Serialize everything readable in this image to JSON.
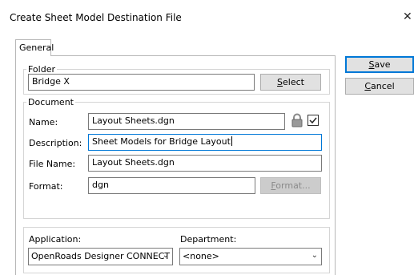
{
  "dialog": {
    "title": "Create Sheet Model Destination File",
    "close": "✕"
  },
  "tabs": [
    {
      "label": "General"
    }
  ],
  "folder": {
    "group_label": "Folder",
    "value": "Bridge X",
    "select_label": "Select"
  },
  "document": {
    "group_label": "Document",
    "name_label": "Name:",
    "name_value": "Layout Sheets.dgn",
    "description_label": "Description:",
    "description_value": "Sheet Models for Bridge Layout",
    "filename_label": "File Name:",
    "filename_value": "Layout Sheets.dgn",
    "format_label": "Format:",
    "format_value": "dgn",
    "format_button": "Format..."
  },
  "application": {
    "label": "Application:",
    "value": "OpenRoads Designer CONNECT"
  },
  "department": {
    "label": "Department:",
    "value": "<none>"
  },
  "buttons": {
    "save": "Save",
    "cancel": "Cancel"
  },
  "icons": {
    "lock": "lock-icon",
    "check": "checkbox-checked"
  },
  "colors": {
    "accent": "#0078d7",
    "button_bg": "#e1e1e1",
    "border": "#7a7a7a"
  }
}
